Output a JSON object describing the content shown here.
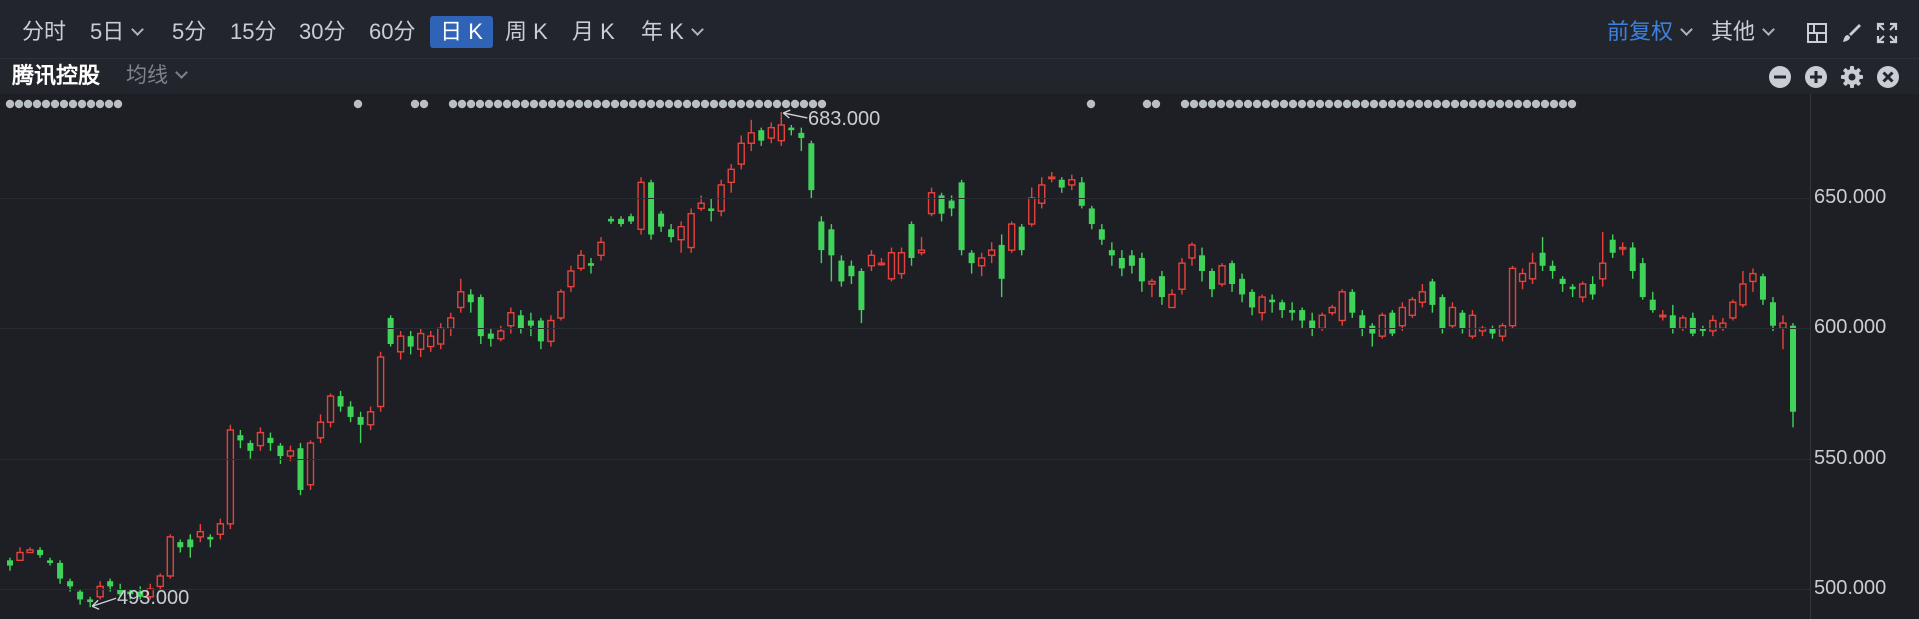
{
  "toolbar": {
    "tabs": [
      {
        "label": "分时",
        "active": false,
        "dropdown": false
      },
      {
        "label": "5日",
        "active": false,
        "dropdown": true
      },
      {
        "label": "5分",
        "active": false,
        "dropdown": false
      },
      {
        "label": "15分",
        "active": false,
        "dropdown": false
      },
      {
        "label": "30分",
        "active": false,
        "dropdown": false
      },
      {
        "label": "60分",
        "active": false,
        "dropdown": false
      },
      {
        "label": "日 K",
        "active": true,
        "dropdown": false
      },
      {
        "label": "周 K",
        "active": false,
        "dropdown": false
      },
      {
        "label": "月 K",
        "active": false,
        "dropdown": false
      },
      {
        "label": "年 K",
        "active": false,
        "dropdown": true
      }
    ],
    "adjust_label": "前复权",
    "other_label": "其他",
    "icons": [
      "layout-icon",
      "brush-icon",
      "fullscreen-icon"
    ]
  },
  "chart_header": {
    "stock_name": "腾讯控股",
    "ma_label": "均线",
    "icons": [
      "zoom-out-icon",
      "zoom-in-icon",
      "settings-icon",
      "close-icon"
    ]
  },
  "colors": {
    "up": "#e8413b",
    "down": "#3fd35a",
    "accent": "#2f63b8",
    "adjust_text": "#3b82e0",
    "background": "#1d1f25"
  },
  "chart_data": {
    "type": "candlestick",
    "ylim": [
      493,
      683
    ],
    "y_ticks": [
      "650.000",
      "600.000",
      "550.000",
      "500.000"
    ],
    "y_tick_values": [
      650,
      600,
      550,
      500
    ],
    "annotations": {
      "high": "683.000",
      "low": "493.000"
    },
    "candles": [
      [
        511,
        509,
        512,
        507
      ],
      [
        511,
        514,
        516,
        511
      ],
      [
        514,
        515,
        516,
        514
      ],
      [
        515,
        513,
        516,
        512
      ],
      [
        511,
        510,
        512,
        509
      ],
      [
        510,
        504,
        511,
        502
      ],
      [
        503,
        501,
        504,
        499
      ],
      [
        499,
        496,
        500,
        494
      ],
      [
        496,
        495,
        497,
        493
      ],
      [
        497,
        501,
        503,
        496
      ],
      [
        503,
        501,
        504,
        499
      ],
      [
        500,
        498,
        502,
        497
      ],
      [
        499,
        498,
        500,
        496
      ],
      [
        499,
        497,
        501,
        496
      ],
      [
        497,
        500,
        502,
        496
      ],
      [
        501,
        505,
        506,
        500
      ],
      [
        505,
        520,
        521,
        504
      ],
      [
        518,
        516,
        519,
        514
      ],
      [
        519,
        516,
        521,
        512
      ],
      [
        520,
        522,
        525,
        518
      ],
      [
        520,
        519,
        521,
        516
      ],
      [
        521,
        525,
        527,
        519
      ],
      [
        525,
        561,
        563,
        523
      ],
      [
        559,
        557,
        561,
        554
      ],
      [
        556,
        553,
        557,
        550
      ],
      [
        555,
        560,
        562,
        553
      ],
      [
        558,
        556,
        560,
        553
      ],
      [
        555,
        551,
        556,
        548
      ],
      [
        551,
        553,
        555,
        549
      ],
      [
        554,
        538,
        556,
        536
      ],
      [
        540,
        556,
        557,
        538
      ],
      [
        558,
        564,
        567,
        556
      ],
      [
        564,
        574,
        575,
        562
      ],
      [
        574,
        570,
        576,
        568
      ],
      [
        570,
        566,
        572,
        564
      ],
      [
        566,
        563,
        568,
        556
      ],
      [
        563,
        568,
        570,
        561
      ],
      [
        570,
        589,
        591,
        568
      ],
      [
        604,
        594,
        605,
        593
      ],
      [
        591,
        597,
        599,
        588
      ],
      [
        597,
        593,
        599,
        590
      ],
      [
        592,
        598,
        600,
        589
      ],
      [
        593,
        597,
        599,
        591
      ],
      [
        594,
        600,
        602,
        592
      ],
      [
        600,
        604,
        606,
        597
      ],
      [
        608,
        614,
        619,
        606
      ],
      [
        613,
        610,
        615,
        606
      ],
      [
        612,
        597,
        613,
        594
      ],
      [
        598,
        596,
        600,
        593
      ],
      [
        596,
        599,
        601,
        595
      ],
      [
        601,
        606,
        608,
        598
      ],
      [
        605,
        600,
        607,
        598
      ],
      [
        603,
        601,
        606,
        597
      ],
      [
        603,
        595,
        604,
        592
      ],
      [
        595,
        603,
        605,
        593
      ],
      [
        604,
        614,
        615,
        603
      ],
      [
        616,
        622,
        624,
        614
      ],
      [
        623,
        628,
        630,
        622
      ],
      [
        625,
        624,
        627,
        621
      ],
      [
        628,
        633,
        635,
        626
      ],
      [
        642,
        641,
        643,
        640
      ],
      [
        642,
        640,
        643,
        639
      ],
      [
        643,
        641,
        644,
        640
      ],
      [
        638,
        656,
        658,
        636
      ],
      [
        656,
        636,
        657,
        634
      ],
      [
        644,
        639,
        645,
        637
      ],
      [
        638,
        635,
        640,
        633
      ],
      [
        634,
        639,
        641,
        629
      ],
      [
        631,
        644,
        646,
        629
      ],
      [
        646,
        648,
        651,
        645
      ],
      [
        646,
        645,
        650,
        641
      ],
      [
        645,
        655,
        657,
        643
      ],
      [
        656,
        661,
        663,
        652
      ],
      [
        663,
        671,
        674,
        661
      ],
      [
        671,
        675,
        680,
        668
      ],
      [
        676,
        672,
        677,
        670
      ],
      [
        673,
        677,
        679,
        671
      ],
      [
        672,
        678,
        683,
        670
      ],
      [
        677,
        676,
        678,
        674
      ],
      [
        675,
        673,
        677,
        668
      ],
      [
        671,
        653,
        672,
        650
      ],
      [
        641,
        630,
        643,
        625
      ],
      [
        638,
        628,
        640,
        618
      ],
      [
        626,
        618,
        628,
        616
      ],
      [
        624,
        620,
        626,
        617
      ],
      [
        622,
        607,
        623,
        602
      ],
      [
        624,
        628,
        630,
        622
      ],
      [
        625,
        625,
        627,
        624
      ],
      [
        619,
        629,
        631,
        618
      ],
      [
        621,
        629,
        631,
        619
      ],
      [
        640,
        627,
        641,
        624
      ],
      [
        629,
        630,
        635,
        628
      ],
      [
        644,
        652,
        654,
        643
      ],
      [
        651,
        644,
        652,
        641
      ],
      [
        649,
        646,
        651,
        643
      ],
      [
        656,
        630,
        657,
        628
      ],
      [
        629,
        625,
        630,
        621
      ],
      [
        624,
        627,
        629,
        620
      ],
      [
        628,
        630,
        633,
        625
      ],
      [
        632,
        619,
        636,
        612
      ],
      [
        630,
        640,
        641,
        629
      ],
      [
        639,
        630,
        640,
        628
      ],
      [
        640,
        650,
        654,
        639
      ],
      [
        648,
        655,
        658,
        646
      ],
      [
        658,
        658,
        660,
        656
      ],
      [
        657,
        654,
        658,
        652
      ],
      [
        655,
        657,
        659,
        653
      ],
      [
        656,
        647,
        658,
        646
      ],
      [
        646,
        640,
        647,
        638
      ],
      [
        638,
        634,
        640,
        632
      ],
      [
        630,
        628,
        633,
        624
      ],
      [
        627,
        623,
        630,
        620
      ],
      [
        628,
        624,
        630,
        621
      ],
      [
        627,
        618,
        629,
        614
      ],
      [
        617,
        618,
        619,
        612
      ],
      [
        620,
        612,
        622,
        609
      ],
      [
        608,
        613,
        615,
        608
      ],
      [
        615,
        625,
        627,
        613
      ],
      [
        627,
        632,
        633,
        624
      ],
      [
        628,
        622,
        631,
        618
      ],
      [
        622,
        615,
        623,
        612
      ],
      [
        617,
        624,
        625,
        616
      ],
      [
        625,
        617,
        626,
        614
      ],
      [
        619,
        613,
        621,
        610
      ],
      [
        614,
        608,
        615,
        605
      ],
      [
        606,
        612,
        613,
        603
      ],
      [
        611,
        610,
        613,
        606
      ],
      [
        610,
        607,
        611,
        604
      ],
      [
        607,
        606,
        610,
        603
      ],
      [
        607,
        603,
        608,
        600
      ],
      [
        603,
        600,
        606,
        597
      ],
      [
        600,
        605,
        606,
        599
      ],
      [
        606,
        608,
        609,
        605
      ],
      [
        603,
        614,
        615,
        601
      ],
      [
        614,
        606,
        615,
        604
      ],
      [
        605,
        600,
        607,
        597
      ],
      [
        601,
        598,
        602,
        593
      ],
      [
        597,
        605,
        606,
        596
      ],
      [
        606,
        598,
        607,
        597
      ],
      [
        601,
        608,
        610,
        599
      ],
      [
        605,
        611,
        612,
        604
      ],
      [
        610,
        614,
        617,
        608
      ],
      [
        618,
        609,
        619,
        606
      ],
      [
        612,
        600,
        613,
        598
      ],
      [
        601,
        608,
        610,
        600
      ],
      [
        606,
        600,
        607,
        598
      ],
      [
        597,
        605,
        607,
        596
      ],
      [
        599,
        600,
        601,
        597
      ],
      [
        600,
        598,
        601,
        596
      ],
      [
        597,
        601,
        602,
        595
      ],
      [
        601,
        623,
        624,
        600
      ],
      [
        618,
        621,
        623,
        615
      ],
      [
        619,
        625,
        629,
        617
      ],
      [
        629,
        624,
        635,
        622
      ],
      [
        624,
        622,
        626,
        619
      ],
      [
        619,
        617,
        620,
        614
      ],
      [
        616,
        615,
        617,
        612
      ],
      [
        612,
        617,
        618,
        610
      ],
      [
        617,
        613,
        620,
        611
      ],
      [
        619,
        625,
        637,
        616
      ],
      [
        634,
        629,
        636,
        627
      ],
      [
        631,
        631,
        633,
        628
      ],
      [
        631,
        622,
        633,
        619
      ],
      [
        625,
        612,
        627,
        611
      ],
      [
        611,
        607,
        614,
        606
      ],
      [
        605,
        605,
        607,
        603
      ],
      [
        605,
        600,
        609,
        598
      ],
      [
        600,
        604,
        605,
        599
      ],
      [
        604,
        598,
        606,
        597
      ],
      [
        600,
        599,
        601,
        597
      ],
      [
        599,
        603,
        605,
        597
      ],
      [
        600,
        602,
        604,
        599
      ],
      [
        604,
        610,
        611,
        603
      ],
      [
        609,
        617,
        622,
        608
      ],
      [
        618,
        621,
        623,
        614
      ],
      [
        620,
        611,
        621,
        609
      ],
      [
        610,
        601,
        612,
        599
      ],
      [
        600,
        602,
        605,
        592
      ],
      [
        601,
        568,
        602,
        562
      ]
    ],
    "dots": [
      {
        "count": 13
      },
      {
        "count": 1
      },
      {
        "count": 2
      },
      {
        "count": 42
      },
      {
        "count": 1
      },
      {
        "count": 2
      },
      {
        "count": 44
      }
    ]
  }
}
